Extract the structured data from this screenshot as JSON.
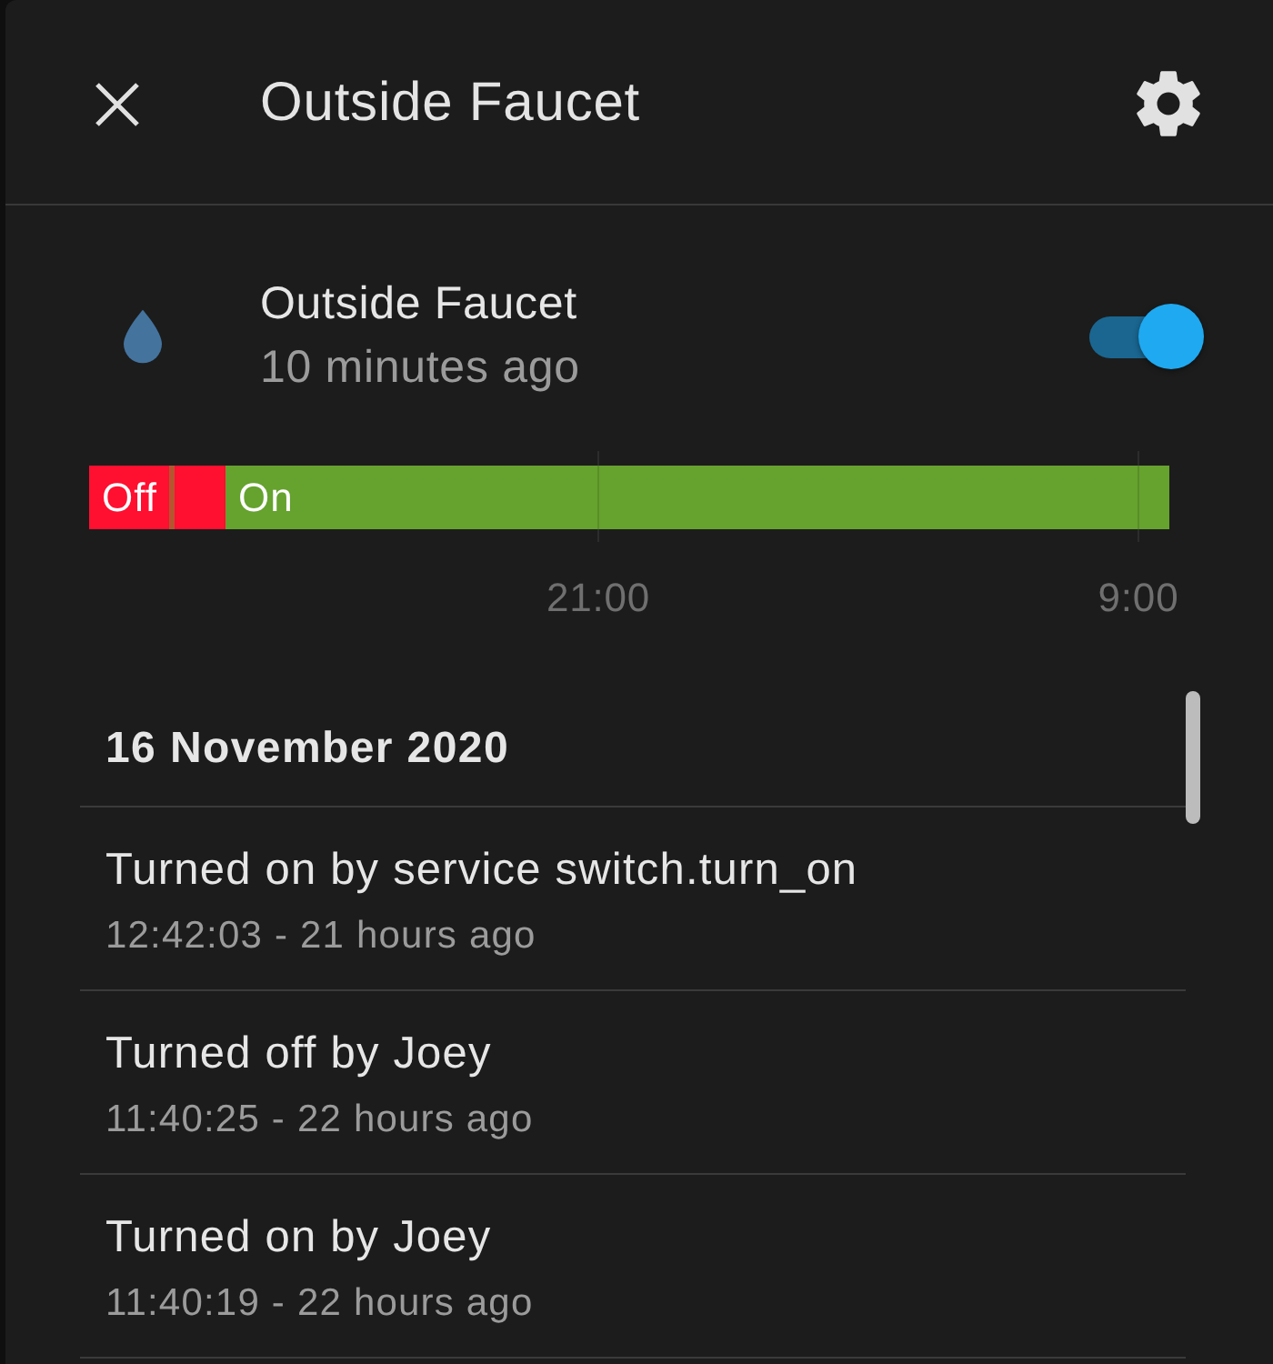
{
  "header": {
    "title": "Outside Faucet"
  },
  "entity": {
    "name": "Outside Faucet",
    "last_changed": "10 minutes ago",
    "on": true
  },
  "history": {
    "timeline": {
      "segments": [
        {
          "label": "Off",
          "color": "#ff0f30"
        },
        {
          "color": "#b4552f"
        },
        {
          "color": "#ff0f30"
        },
        {
          "label": "On",
          "color": "#66a22e"
        }
      ],
      "ticks": [
        "21:00",
        "9:00"
      ]
    }
  },
  "logbook": {
    "date": "16 November 2020",
    "entries": [
      {
        "message": "Turned on by service switch.turn_on",
        "time": "12:42:03 - 21 hours ago"
      },
      {
        "message": "Turned off by Joey",
        "time": "11:40:25 - 22 hours ago"
      },
      {
        "message": "Turned on by Joey",
        "time": "11:40:19 - 22 hours ago"
      }
    ]
  }
}
